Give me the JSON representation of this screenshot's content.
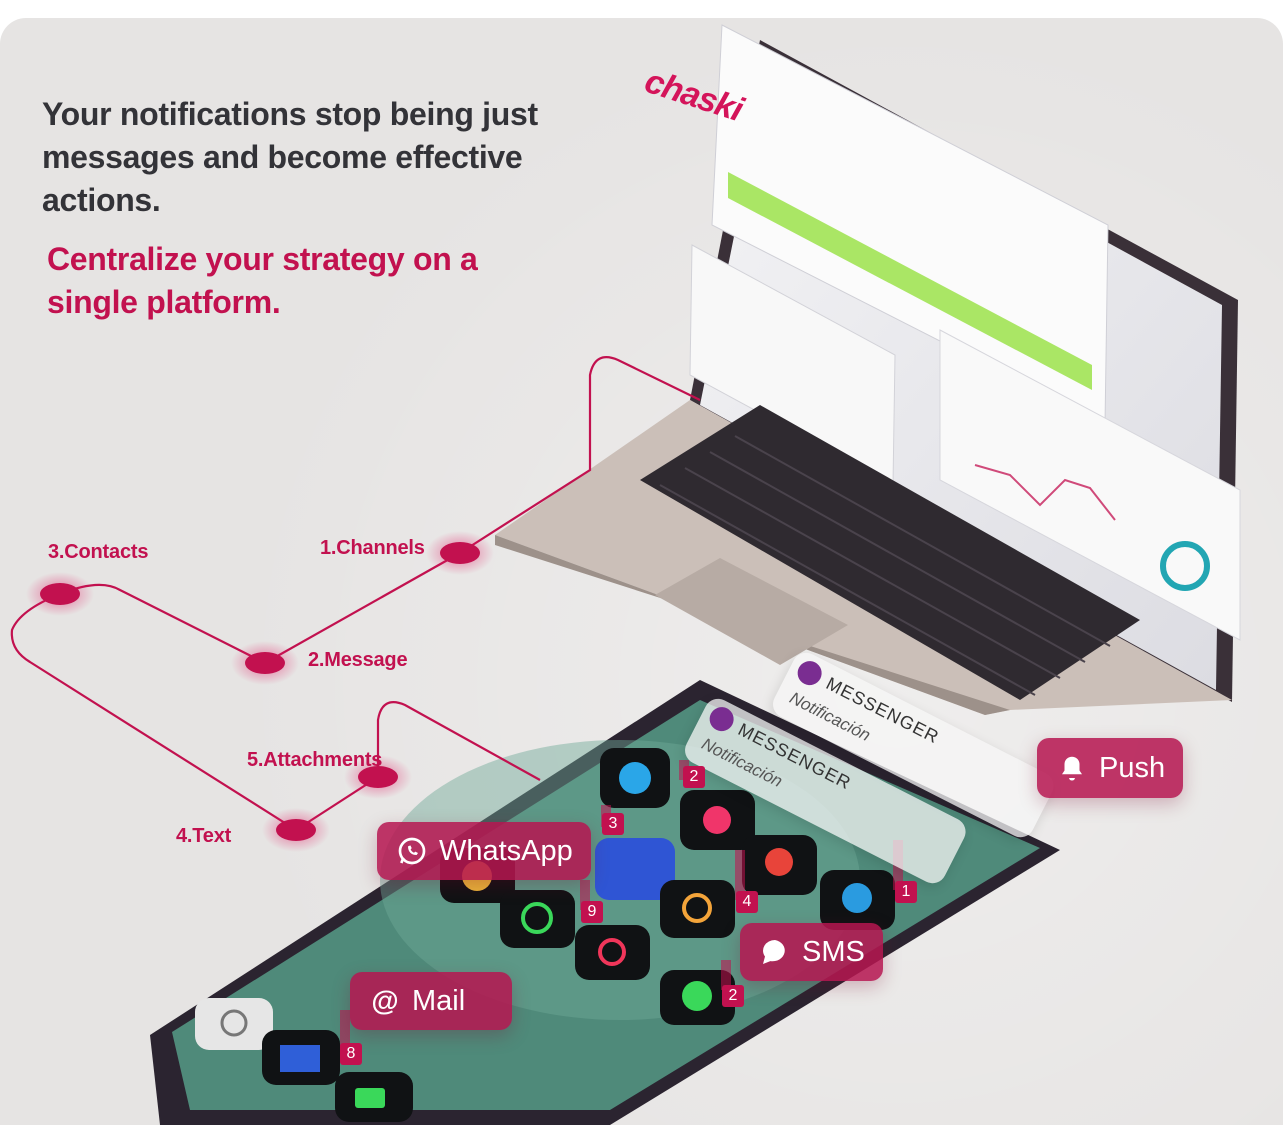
{
  "headline": "Your notifications stop being just messages and become effective actions.",
  "subheadline": "Centralize your strategy on a single platform.",
  "brand": "chaski",
  "flow_steps": [
    {
      "label": "1.Channels"
    },
    {
      "label": "2.Message"
    },
    {
      "label": "3.Contacts"
    },
    {
      "label": "4.Text"
    },
    {
      "label": "5.Attachments"
    }
  ],
  "channels": {
    "push": "Push",
    "whatsapp": "WhatsApp",
    "sms": "SMS",
    "mail": "Mail"
  },
  "notifications": [
    {
      "title": "MESSENGER",
      "body": "Notificación"
    },
    {
      "title": "MESSENGER",
      "body": "Notificación"
    }
  ],
  "app_badges": [
    "2",
    "3",
    "9",
    "4",
    "1",
    "2",
    "8"
  ],
  "colors": {
    "accent": "#c2114f",
    "background": "#e6e4e3",
    "heading": "#333338",
    "laptop_body": "#cfc3bc",
    "phone_body": "#2b2430",
    "phone_screen": "#4f8a7a"
  }
}
